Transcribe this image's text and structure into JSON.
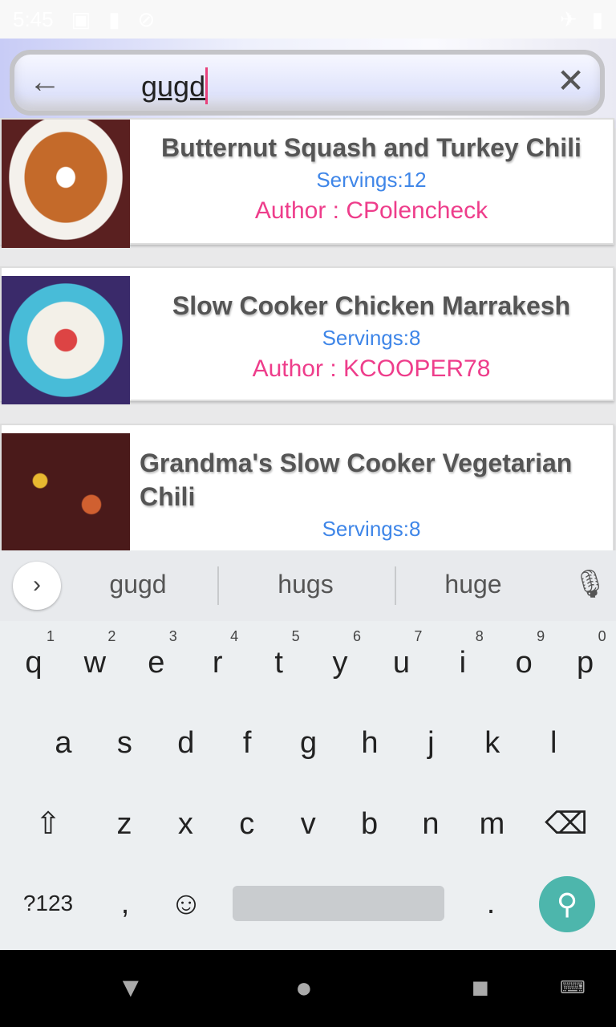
{
  "status": {
    "time": "5:45"
  },
  "search": {
    "query": "gugd"
  },
  "recipes": [
    {
      "title": "Butternut Squash and Turkey Chili",
      "servings": "Servings:12",
      "author": "Author : CPolencheck"
    },
    {
      "title": "Slow Cooker Chicken Marrakesh",
      "servings": "Servings:8",
      "author": "Author : KCOOPER78"
    },
    {
      "title": "Grandma's Slow Cooker Vegetarian Chili",
      "servings": "Servings:8"
    }
  ],
  "keyboard": {
    "suggestions": [
      "gugd",
      "hugs",
      "huge"
    ],
    "row1": [
      [
        "q",
        "1"
      ],
      [
        "w",
        "2"
      ],
      [
        "e",
        "3"
      ],
      [
        "r",
        "4"
      ],
      [
        "t",
        "5"
      ],
      [
        "y",
        "6"
      ],
      [
        "u",
        "7"
      ],
      [
        "i",
        "8"
      ],
      [
        "o",
        "9"
      ],
      [
        "p",
        "0"
      ]
    ],
    "row2": [
      "a",
      "s",
      "d",
      "f",
      "g",
      "h",
      "j",
      "k",
      "l"
    ],
    "row3": [
      "z",
      "x",
      "c",
      "v",
      "b",
      "n",
      "m"
    ],
    "symbols": "?123",
    "comma": ",",
    "period": "."
  }
}
